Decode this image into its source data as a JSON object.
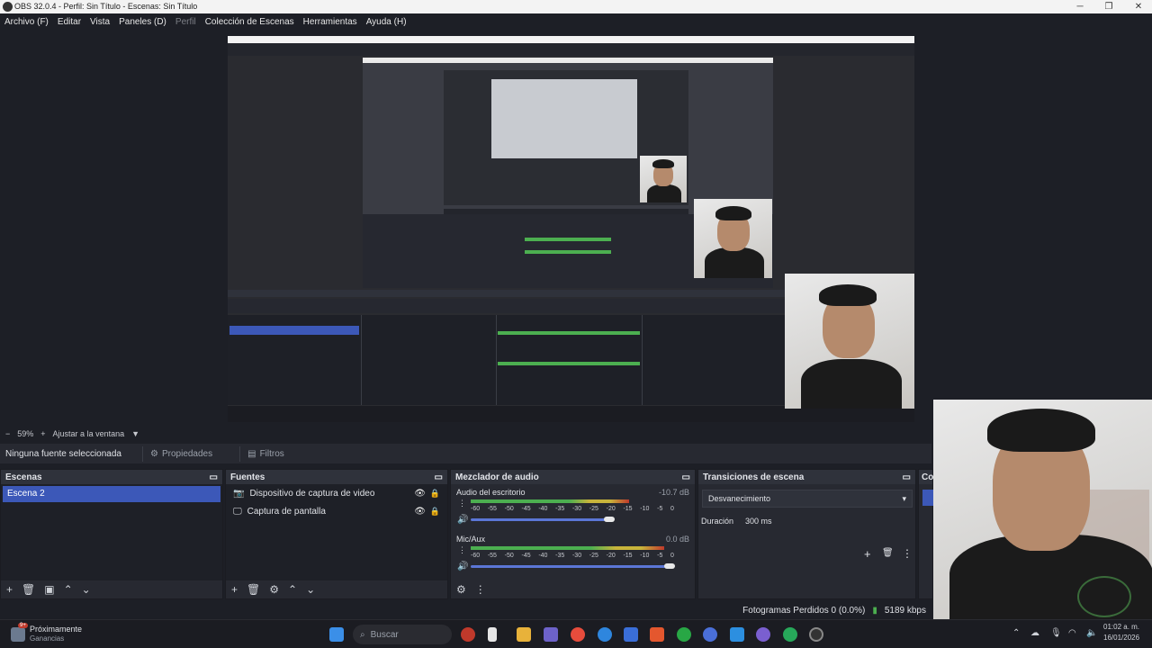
{
  "window": {
    "title": "OBS 32.0.4 - Perfil: Sin Título - Escenas: Sin Título",
    "min": "─",
    "max": "❐",
    "close": "✕"
  },
  "menu": [
    {
      "label": "Archivo (F)",
      "dim": false
    },
    {
      "label": "Editar",
      "dim": false
    },
    {
      "label": "Vista",
      "dim": false
    },
    {
      "label": "Paneles (D)",
      "dim": false
    },
    {
      "label": "Perfil",
      "dim": true
    },
    {
      "label": "Colección de Escenas",
      "dim": false
    },
    {
      "label": "Herramientas",
      "dim": false
    },
    {
      "label": "Ayuda (H)",
      "dim": false
    }
  ],
  "zoom": {
    "minus": "−",
    "value": "59%",
    "plus": "+",
    "fit": "Ajustar a la ventana",
    "caret": "▼"
  },
  "source_bar": {
    "status": "Ninguna fuente seleccionada",
    "properties": "Propiedades",
    "filters": "Filtros"
  },
  "scenes": {
    "title": "Escenas",
    "items": [
      "Escena 2"
    ]
  },
  "sources": {
    "title": "Fuentes",
    "items": [
      "Dispositivo de captura de video",
      "Captura de pantalla"
    ]
  },
  "mixer": {
    "title": "Mezclador de audio",
    "channels": [
      {
        "name": "Audio del escritorio",
        "db": "-10.7 dB",
        "level": 0.78,
        "volume": 0.68
      },
      {
        "name": "Mic/Aux",
        "db": "0.0 dB",
        "level": 0.95,
        "volume": 0.98
      }
    ],
    "ticks": [
      "-60",
      "-55",
      "-50",
      "-45",
      "-40",
      "-35",
      "-30",
      "-25",
      "-20",
      "-15",
      "-10",
      "-5",
      "0"
    ]
  },
  "transitions": {
    "title": "Transiciones de escena",
    "selected": "Desvanecimiento",
    "duration_label": "Duración",
    "duration_value": "300 ms"
  },
  "controls": {
    "title": "Co"
  },
  "status": {
    "frames": "Fotogramas Perdidos 0 (0.0%)",
    "bitrate": "5189 kbps"
  },
  "taskbar": {
    "widget_title": "Próximamente",
    "widget_sub": "Ganancias",
    "badge": "9+",
    "search": "Buscar",
    "time": "01:02 a. m.",
    "date": "16/01/2026"
  },
  "colors": {
    "accent": "#3c58b8",
    "meter_green": "#4caf50",
    "meter_yellow": "#c8b43b",
    "meter_red": "#c0392b"
  }
}
